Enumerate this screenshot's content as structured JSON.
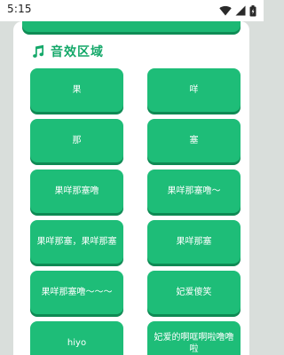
{
  "status_bar": {
    "time": "5:15",
    "icons": [
      "wifi-icon",
      "signal-icon",
      "battery-icon"
    ]
  },
  "section": {
    "icon": "music-note-icon",
    "title": "音效区域"
  },
  "sound_buttons": [
    {
      "label": "果"
    },
    {
      "label": "咩"
    },
    {
      "label": "那"
    },
    {
      "label": "塞"
    },
    {
      "label": "果咩那塞噜"
    },
    {
      "label": "果咩那塞噜～"
    },
    {
      "label": "果咩那塞，果咩那塞"
    },
    {
      "label": "果咩那塞"
    },
    {
      "label": "果咩那塞噜～～～"
    },
    {
      "label": "妃爱傻笑"
    },
    {
      "label": "hiyo"
    },
    {
      "label": "妃爱的啊哐啊啦噜噜啦"
    }
  ],
  "colors": {
    "accent": "#1ebd78",
    "accent_shadow": "#0f8a54",
    "title_green": "#14a869",
    "background": "#d9dedb",
    "panel": "#ffffff"
  }
}
